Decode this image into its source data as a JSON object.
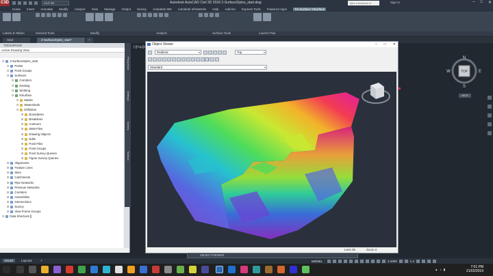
{
  "app": {
    "logo": "C3D",
    "workspace": "Civil 3D",
    "title": "Autodesk AutoCAD Civil 3D 2018   2-SurfaceStyles_start.dwg",
    "search_placeholder": "Type a keyword or phrase",
    "sign_in": "Sign In"
  },
  "menu_tabs": [
    "Home",
    "Insert",
    "Annotate",
    "Modify",
    "Analyze",
    "View",
    "Manage",
    "Output",
    "Survey",
    "Autodesk 360",
    "Autodesk InfraWorks",
    "Help",
    "Add-ins",
    "Express Tools",
    "Featured Apps",
    "Tin Surface: NSurface"
  ],
  "active_menu_tab_index": 15,
  "ribbon_panels": [
    "Labels & Tables",
    "General Tools",
    "Modify",
    "Analyze",
    "Surface Tools",
    "Launch Pad"
  ],
  "doc_tabs": [
    "Start",
    "2-SurfaceStyles_start*",
    "+"
  ],
  "toolspace": {
    "header": "TOOLSPACE",
    "subheader": "Active Drawing View",
    "tree": [
      {
        "label": "2-SurfaceStyles_start",
        "level": 0,
        "icon": "drawing-icon"
      },
      {
        "label": "Points",
        "level": 1,
        "icon": "points-icon"
      },
      {
        "label": "Point Groups",
        "level": 1,
        "icon": "point-groups-icon"
      },
      {
        "label": "Surfaces",
        "level": 1,
        "icon": "surfaces-icon"
      },
      {
        "label": "Corridors",
        "level": 2,
        "icon": "surface-icon"
      },
      {
        "label": "Existing",
        "level": 2,
        "icon": "surface-icon"
      },
      {
        "label": "Working",
        "level": 2,
        "icon": "surface-icon"
      },
      {
        "label": "NSurface",
        "level": 2,
        "icon": "surface-icon"
      },
      {
        "label": "Masks",
        "level": 3,
        "icon": "masks-icon"
      },
      {
        "label": "Watersheds",
        "level": 3,
        "icon": "watersheds-icon"
      },
      {
        "label": "Definition",
        "level": 3,
        "icon": "definition-icon"
      },
      {
        "label": "Boundaries",
        "level": 4,
        "icon": "boundaries-icon"
      },
      {
        "label": "Breaklines",
        "level": 4,
        "icon": "breaklines-icon"
      },
      {
        "label": "Contours",
        "level": 4,
        "icon": "contours-icon"
      },
      {
        "label": "DEM Files",
        "level": 4,
        "icon": "dem-icon"
      },
      {
        "label": "Drawing Objects",
        "level": 4,
        "icon": "drawing-objects-icon"
      },
      {
        "label": "Edits",
        "level": 4,
        "icon": "edits-icon"
      },
      {
        "label": "Point Files",
        "level": 4,
        "icon": "point-files-icon"
      },
      {
        "label": "Point Groups",
        "level": 4,
        "icon": "point-groups-icon"
      },
      {
        "label": "Point Survey Queries",
        "level": 4,
        "icon": "query-icon"
      },
      {
        "label": "Figure Survey Queries",
        "level": 4,
        "icon": "query-icon"
      },
      {
        "label": "Alignments",
        "level": 1,
        "icon": "alignments-icon"
      },
      {
        "label": "Feature Lines",
        "level": 1,
        "icon": "feature-lines-icon"
      },
      {
        "label": "Sites",
        "level": 1,
        "icon": "sites-icon"
      },
      {
        "label": "Catchments",
        "level": 1,
        "icon": "catchments-icon"
      },
      {
        "label": "Pipe Networks",
        "level": 1,
        "icon": "pipe-networks-icon"
      },
      {
        "label": "Pressure Networks",
        "level": 1,
        "icon": "pressure-networks-icon"
      },
      {
        "label": "Corridors",
        "level": 1,
        "icon": "corridors-icon"
      },
      {
        "label": "Assemblies",
        "level": 1,
        "icon": "assemblies-icon"
      },
      {
        "label": "Intersections",
        "level": 1,
        "icon": "intersections-icon"
      },
      {
        "label": "Survey",
        "level": 1,
        "icon": "survey-icon"
      },
      {
        "label": "View Frame Groups",
        "level": 1,
        "icon": "view-frame-icon"
      },
      {
        "label": "Data Shortcuts []",
        "level": 0,
        "icon": "data-shortcuts-icon"
      }
    ],
    "vertical_tabs": [
      "Prospector",
      "Settings",
      "Survey",
      "Toolbox"
    ]
  },
  "viewport_label": "[-][Top][2D W...",
  "object_viewer": {
    "title": "Object Viewer",
    "visual_style": "Realistic",
    "view": "Top",
    "style": "Standard",
    "status": {
      "lens": "Lens 35",
      "zoom": "Zoom 2"
    }
  },
  "viewcube": {
    "north": "N",
    "south": "S",
    "east": "E",
    "west": "W",
    "face": "TOP",
    "wcs": "WCS"
  },
  "command_line": {
    "prompt": "OBJECTVIEWER"
  },
  "layout_tabs": [
    "Model",
    "Layout1",
    "+"
  ],
  "status_bar": {
    "model": "MODEL",
    "scale": "1:1000",
    "scale2": "1.4"
  },
  "taskbar": {
    "time": "7:01 PM",
    "date": "21/02/2019"
  },
  "colors": {
    "accent": "#6b7f8e",
    "surface_hi": "#e6007e",
    "surface_lo": "#7b2fbf"
  }
}
